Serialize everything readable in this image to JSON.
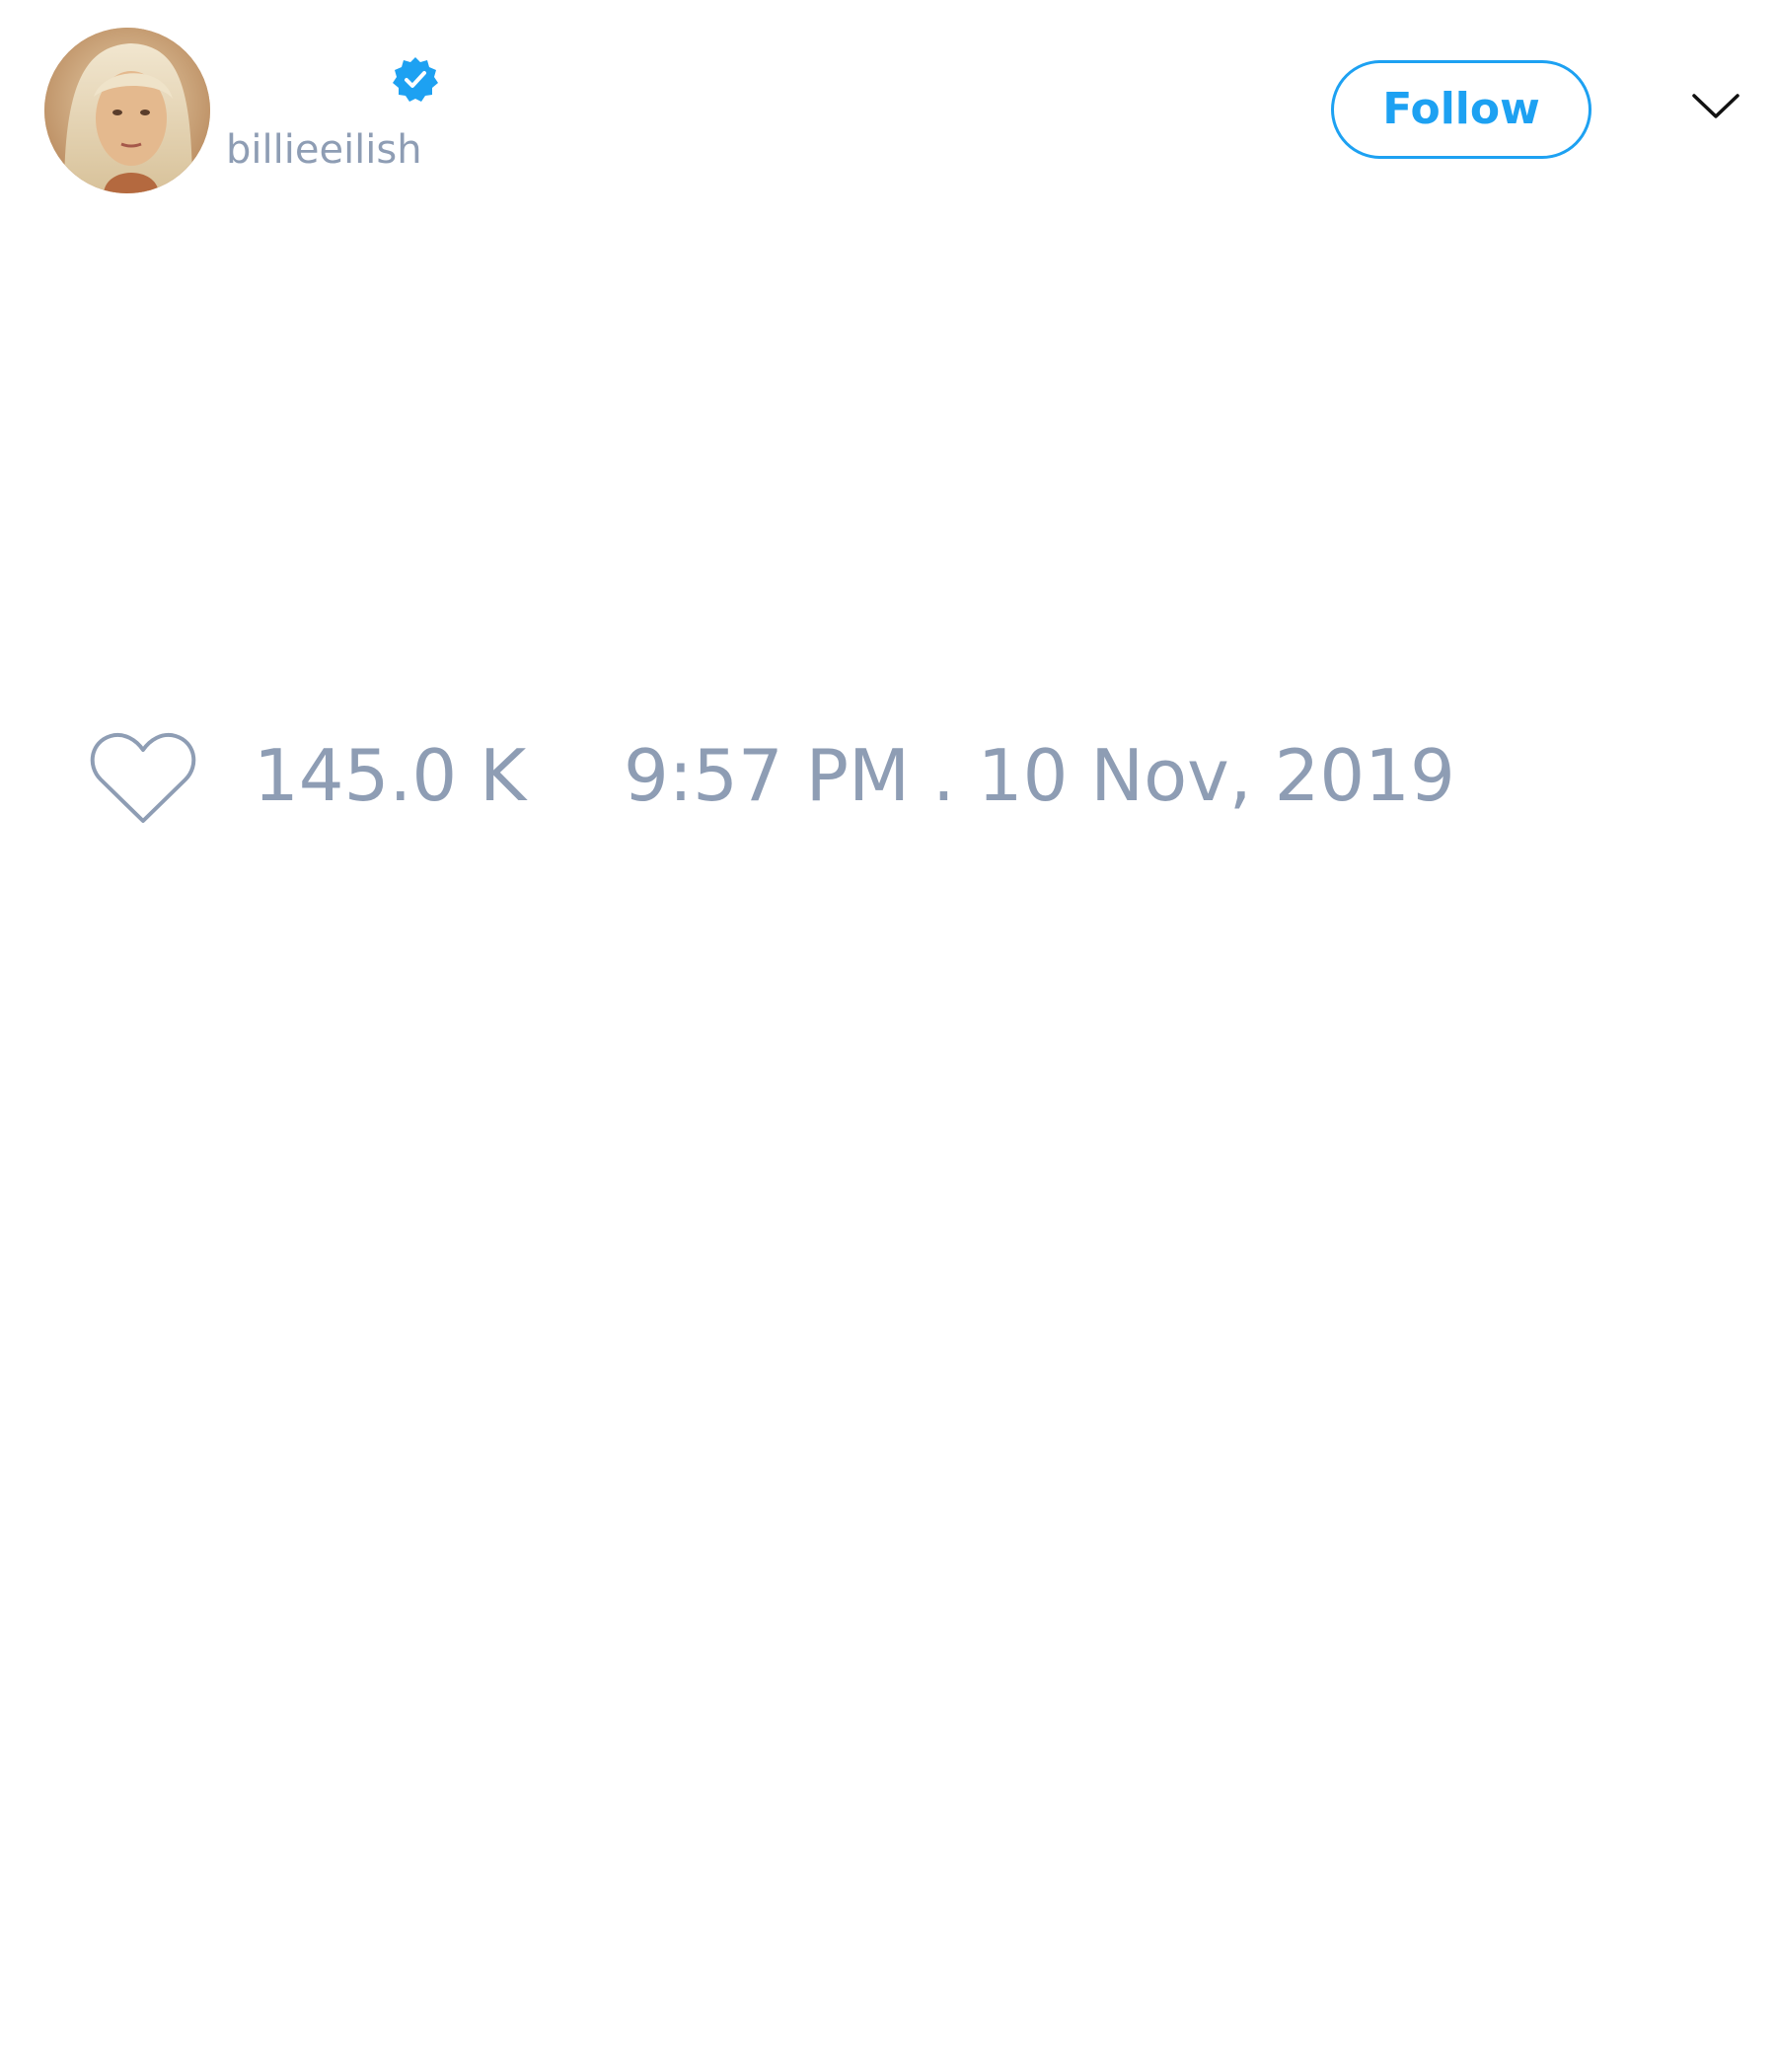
{
  "tweet": {
    "author": {
      "handle": "billieeilish",
      "avatar_icon": "user-avatar",
      "verified_icon": "verified-badge-icon"
    },
    "follow_label": "Follow",
    "menu_icon": "chevron-down-icon",
    "like_icon": "heart-icon",
    "like_count": "145.0 K",
    "timestamp": "9:57 PM . 10 Nov, 2019"
  },
  "colors": {
    "accent": "#1da1f2",
    "muted_text": "#8e9db4",
    "background": "#ffffff"
  }
}
